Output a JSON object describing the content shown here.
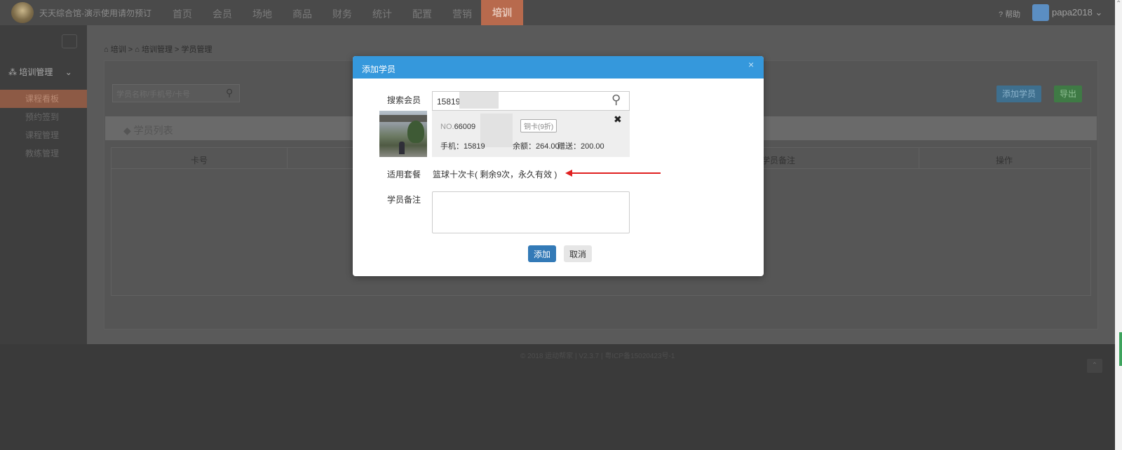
{
  "app": {
    "title": "天天综合馆-演示使用请勿预订",
    "logo_icon": "logo-badge"
  },
  "nav": {
    "items": [
      "首页",
      "会员",
      "场地",
      "商品",
      "财务",
      "统计",
      "配置",
      "营销",
      "培训"
    ],
    "active": "培训",
    "help": "帮助",
    "help_icon": "question-circle-icon",
    "username": "papa2018"
  },
  "sidebar": {
    "toggle_icon": "menu-icon",
    "group": "培训管理",
    "group_icon": "cubes-icon",
    "items": [
      "课程看板",
      "预约签到",
      "课程管理",
      "教练管理"
    ],
    "active": "课程看板"
  },
  "page": {
    "breadcrumb": [
      "培训",
      "培训管理",
      "学员管理"
    ],
    "search_placeholder": "学员名称/手机号/卡号",
    "add_button": "添加学员",
    "export_button": "导出",
    "list_title": "学员列表",
    "columns": [
      "卡号",
      "学员备注",
      "操作"
    ],
    "copyright": "© 2018 运动帮家 | V2.3.7 | 粤ICP备15020423号-1"
  },
  "modal": {
    "title": "添加学员",
    "search_label": "搜索会员",
    "search_value": "15819",
    "member": {
      "no_prefix": "NO.",
      "no": "66009",
      "card_type": "铜卡(9折)",
      "phone_label": "手机：",
      "phone": "15819",
      "balance_label": "余额：",
      "balance": "264.00",
      "gift_label": "赠送：",
      "gift": "200.00"
    },
    "package_label": "适用套餐",
    "package_value": "篮球十次卡( 剩余9次，永久有效 )",
    "remark_label": "学员备注",
    "remark_value": "",
    "add_button": "添加",
    "cancel_button": "取消"
  },
  "colors": {
    "accent": "#3598dc",
    "primary_button": "#337ab7",
    "nav_active": "#b86a4d",
    "arrow": "#e02020"
  }
}
